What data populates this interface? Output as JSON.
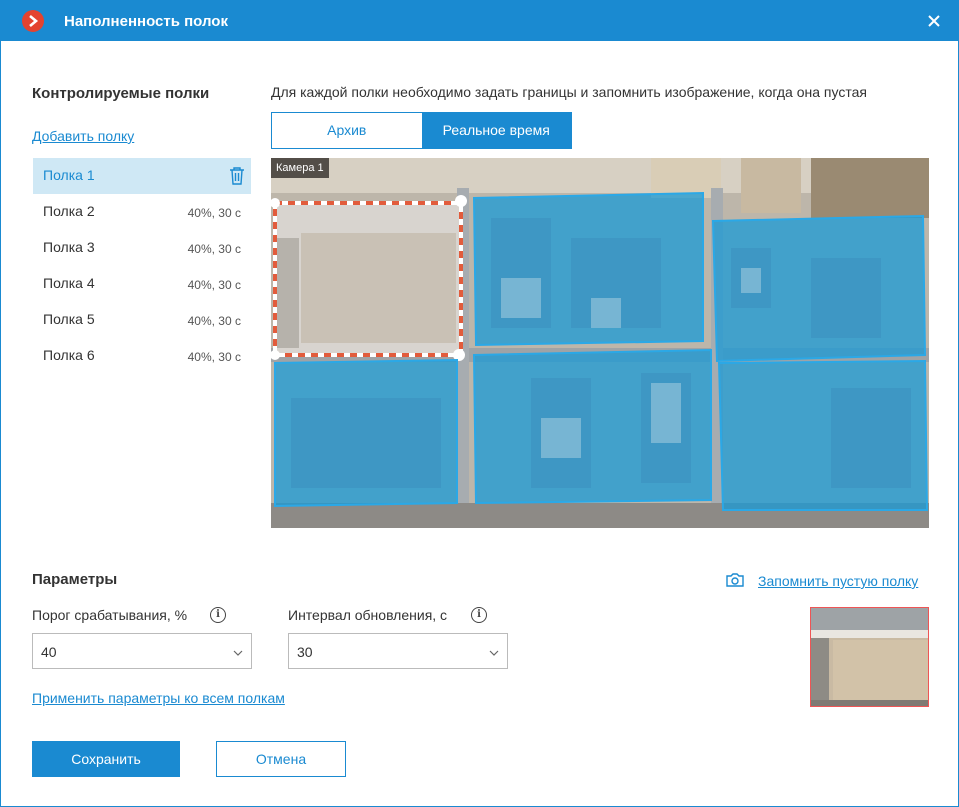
{
  "window": {
    "title": "Наполненность полок"
  },
  "shelves_panel": {
    "title": "Контролируемые полки",
    "add_link": "Добавить полку",
    "items": [
      {
        "label": "Полка 1",
        "meta": "",
        "selected": true
      },
      {
        "label": "Полка 2",
        "meta": "40%, 30 с"
      },
      {
        "label": "Полка 3",
        "meta": "40%, 30 с"
      },
      {
        "label": "Полка 4",
        "meta": "40%, 30 с"
      },
      {
        "label": "Полка 5",
        "meta": "40%, 30 с"
      },
      {
        "label": "Полка 6",
        "meta": "40%, 30 с"
      }
    ]
  },
  "main": {
    "instruction": "Для каждой полки необходимо задать границы и запомнить изображение, когда она пустая",
    "tabs": [
      {
        "label": "Архив",
        "active": false
      },
      {
        "label": "Реальное время",
        "active": true
      }
    ],
    "camera_label": "Камера 1"
  },
  "params": {
    "title": "Параметры",
    "threshold_label": "Порог срабатывания, %",
    "threshold_value": "40",
    "interval_label": "Интервал обновления, с",
    "interval_value": "30",
    "apply_all_link": "Применить параметры ко всем полкам",
    "remember_empty_link": "Запомнить пустую полку"
  },
  "footer": {
    "save_label": "Сохранить",
    "cancel_label": "Отмена"
  },
  "colors": {
    "accent": "#1a8ad1",
    "selected_bg": "#cfe8f5",
    "logo": "#e4432f",
    "zone_fill": "#1a9ad6"
  }
}
